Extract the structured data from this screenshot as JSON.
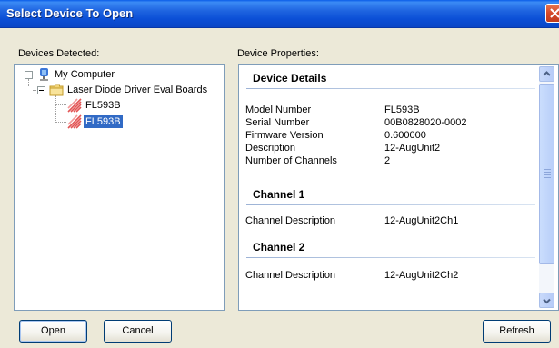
{
  "window": {
    "title": "Select Device To Open"
  },
  "labels": {
    "devices_detected": "Devices Detected:",
    "device_properties": "Device Properties:"
  },
  "tree": {
    "root": "My Computer",
    "group": "Laser Diode Driver Eval Boards",
    "devices": [
      {
        "label": "FL593B",
        "selected": false
      },
      {
        "label": "FL593B",
        "selected": true
      }
    ]
  },
  "details": {
    "heading": "Device Details",
    "rows": [
      {
        "label": "Model Number",
        "value": "FL593B"
      },
      {
        "label": "Serial Number",
        "value": "00B0828020-0002"
      },
      {
        "label": "Firmware Version",
        "value": "0.600000"
      },
      {
        "label": "Description",
        "value": "12-AugUnit2"
      },
      {
        "label": "Number of Channels",
        "value": "2"
      }
    ]
  },
  "channels": [
    {
      "heading": "Channel 1",
      "label": "Channel Description",
      "value": "12-AugUnit2Ch1"
    },
    {
      "heading": "Channel 2",
      "label": "Channel Description",
      "value": "12-AugUnit2Ch2"
    }
  ],
  "buttons": {
    "open_accel": "O",
    "open_rest": "pen",
    "cancel_accel": "C",
    "cancel_rest": "ancel",
    "refresh_accel": "R",
    "refresh_rest": "efresh"
  },
  "colors": {
    "titlebar": "#0A5CE8",
    "selection": "#316AC5",
    "dialog_bg": "#ECE9D8"
  }
}
